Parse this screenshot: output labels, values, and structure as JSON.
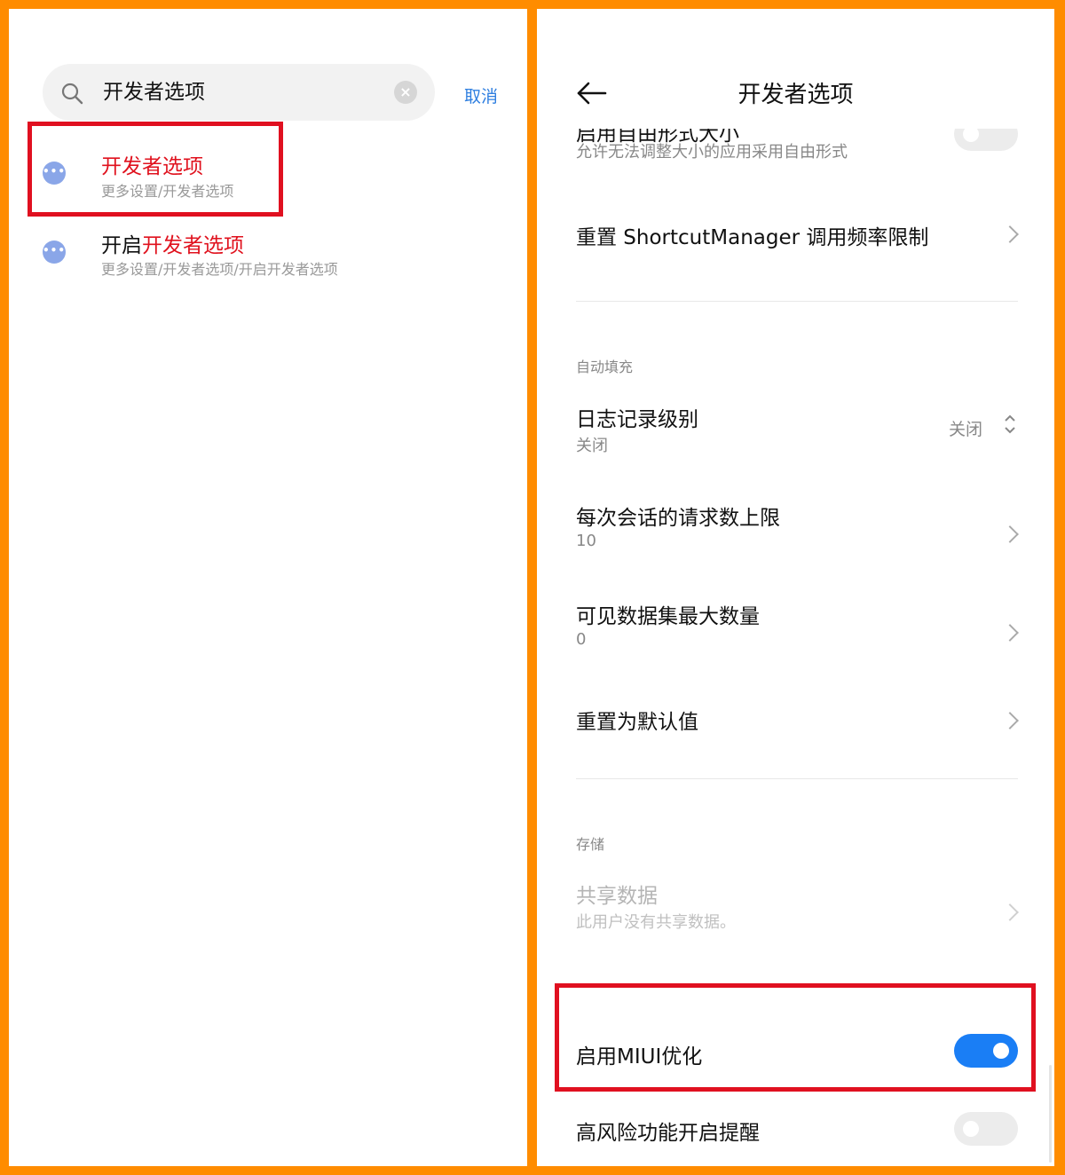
{
  "left": {
    "search": {
      "query": "开发者选项",
      "clear_icon": "×",
      "cancel_label": "取消"
    },
    "results": [
      {
        "icon": "•••",
        "title_prefix": "",
        "title_highlight": "开发者选项",
        "subtitle": "更多设置/开发者选项"
      },
      {
        "icon": "•••",
        "title_prefix": "开启",
        "title_highlight": "开发者选项",
        "subtitle": "更多设置/开发者选项/开启开发者选项"
      }
    ]
  },
  "right": {
    "header": {
      "title": "开发者选项"
    },
    "rows": {
      "freeform": {
        "title": "启用自由形式大小",
        "subtitle": "允许无法调整大小的应用采用自由形式",
        "enabled": false
      },
      "shortcut": {
        "title": "重置 ShortcutManager 调用频率限制"
      },
      "autofill_header": "自动填充",
      "log_level": {
        "title": "日志记录级别",
        "subtitle": "关闭",
        "value": "关闭"
      },
      "max_requests": {
        "title": "每次会话的请求数上限",
        "subtitle": "10"
      },
      "max_datasets": {
        "title": "可见数据集最大数量",
        "subtitle": "0"
      },
      "reset_default": {
        "title": "重置为默认值"
      },
      "storage_header": "存储",
      "shared_data": {
        "title": "共享数据",
        "subtitle": "此用户没有共享数据。"
      },
      "miui_opt": {
        "title": "启用MIUI优化",
        "enabled": true
      },
      "risk_reminder": {
        "title": "高风险功能开启提醒",
        "enabled": false
      }
    }
  },
  "colors": {
    "frame": "#ff8c00",
    "highlight": "#e0121e",
    "accent_blue": "#1a7ef5",
    "link_blue": "#2f7fe0"
  }
}
